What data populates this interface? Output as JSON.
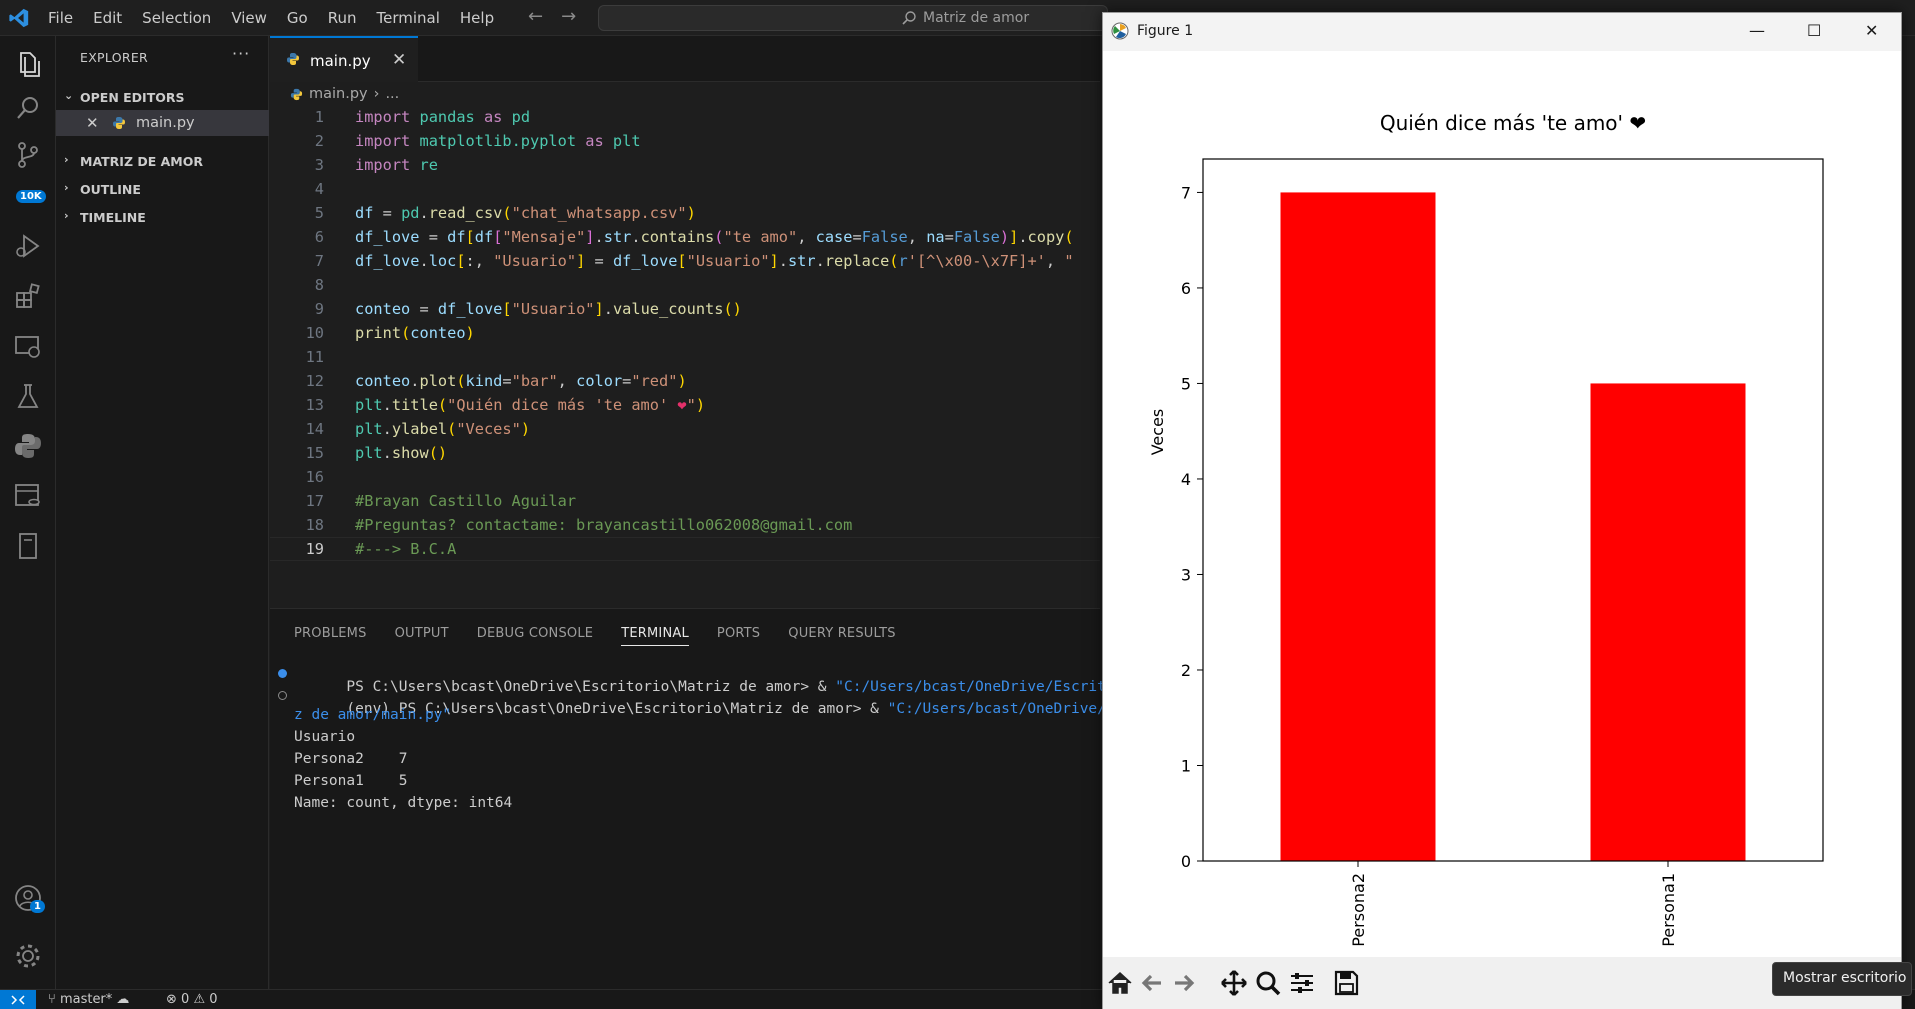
{
  "menu": [
    "File",
    "Edit",
    "Selection",
    "View",
    "Go",
    "Run",
    "Terminal",
    "Help"
  ],
  "command_center": "Matriz de amor",
  "activity": {
    "scm_badge": "10K",
    "accounts_badge": "1"
  },
  "sidebar": {
    "title": "EXPLORER",
    "open_editors": "OPEN EDITORS",
    "open_file": "main.py",
    "sections": [
      "MATRIZ DE AMOR",
      "OUTLINE",
      "TIMELINE"
    ]
  },
  "editor": {
    "tab": "main.py",
    "breadcrumb": [
      "main.py",
      "..."
    ],
    "current_line": 19
  },
  "panel": {
    "tabs": [
      "PROBLEMS",
      "OUTPUT",
      "DEBUG CONSOLE",
      "TERMINAL",
      "PORTS",
      "QUERY RESULTS"
    ],
    "active_tab": "TERMINAL",
    "lines": [
      {
        "prefix": "PS C:\\Users\\bcast\\OneDrive\\Escritorio\\Matriz de amor> & ",
        "path": "\"C:/Users/bcast/OneDrive/Escritori"
      },
      {
        "prefix": "(env) PS C:\\Users\\bcast\\OneDrive\\Escritorio\\Matriz de amor> & ",
        "path": "\"C:/Users/bcast/OneDrive/Esc"
      },
      {
        "prefix": "",
        "path": "z de amor/main.py\""
      },
      {
        "prefix": "Usuario",
        "path": ""
      },
      {
        "prefix": "Persona2    7",
        "path": ""
      },
      {
        "prefix": "Persona1    5",
        "path": ""
      },
      {
        "prefix": "Name: count, dtype: int64",
        "path": ""
      }
    ]
  },
  "status": {
    "branch": "master*",
    "errors": "0",
    "warnings": "0"
  },
  "figure": {
    "window_title": "Figure 1",
    "tooltip": "Mostrar escritorio"
  },
  "chart_data": {
    "type": "bar",
    "title": "Quién dice más 'te amo' ❤",
    "xlabel": "",
    "ylabel": "Veces",
    "categories": [
      "Persona2",
      "Persona1"
    ],
    "values": [
      7,
      5
    ],
    "ylim": [
      0,
      7.35
    ],
    "yticks": [
      0,
      1,
      2,
      3,
      4,
      5,
      6,
      7
    ],
    "color": "#ff0000",
    "grid": false
  },
  "colors": {
    "accent": "#0078d4",
    "bar": "#ff0000"
  }
}
